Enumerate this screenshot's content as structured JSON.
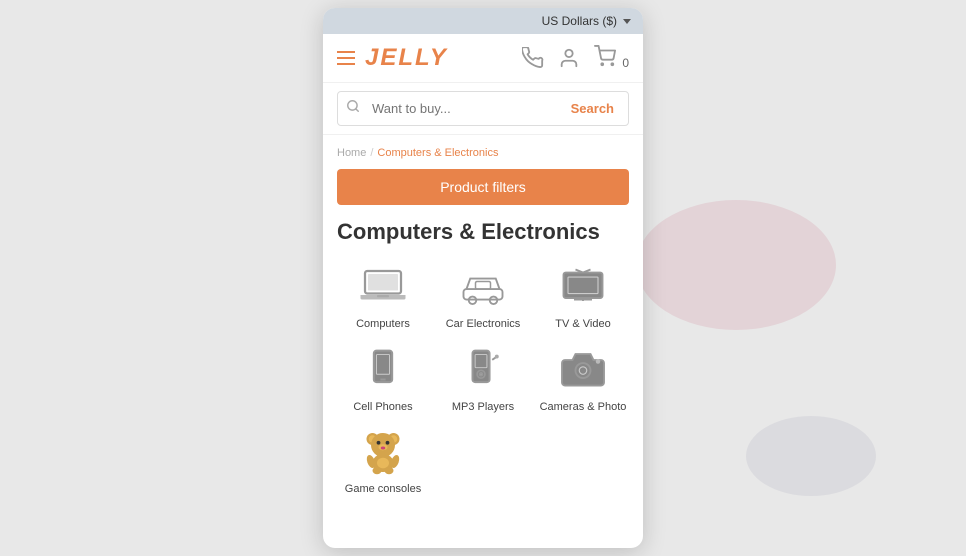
{
  "topbar": {
    "currency": "US Dollars ($)",
    "chevron": "▾"
  },
  "header": {
    "logo": "JELLY",
    "cart_count": "0"
  },
  "search": {
    "placeholder": "Want to buy...",
    "button_label": "Search"
  },
  "breadcrumb": {
    "home": "Home",
    "separator": "/",
    "current": "Computers & Electronics"
  },
  "filter_button": "Product filters",
  "page_title": "Computers & Electronics",
  "categories": [
    {
      "id": "computers",
      "label": "Computers",
      "icon": "laptop"
    },
    {
      "id": "car-electronics",
      "label": "Car Electronics",
      "icon": "car"
    },
    {
      "id": "tv-video",
      "label": "TV & Video",
      "icon": "tv"
    },
    {
      "id": "cell-phones",
      "label": "Cell Phones",
      "icon": "phone"
    },
    {
      "id": "mp3-players",
      "label": "MP3 Players",
      "icon": "mp3"
    },
    {
      "id": "cameras",
      "label": "Cameras & Photo",
      "icon": "camera"
    },
    {
      "id": "game-consoles",
      "label": "Game consoles",
      "icon": "game"
    }
  ]
}
